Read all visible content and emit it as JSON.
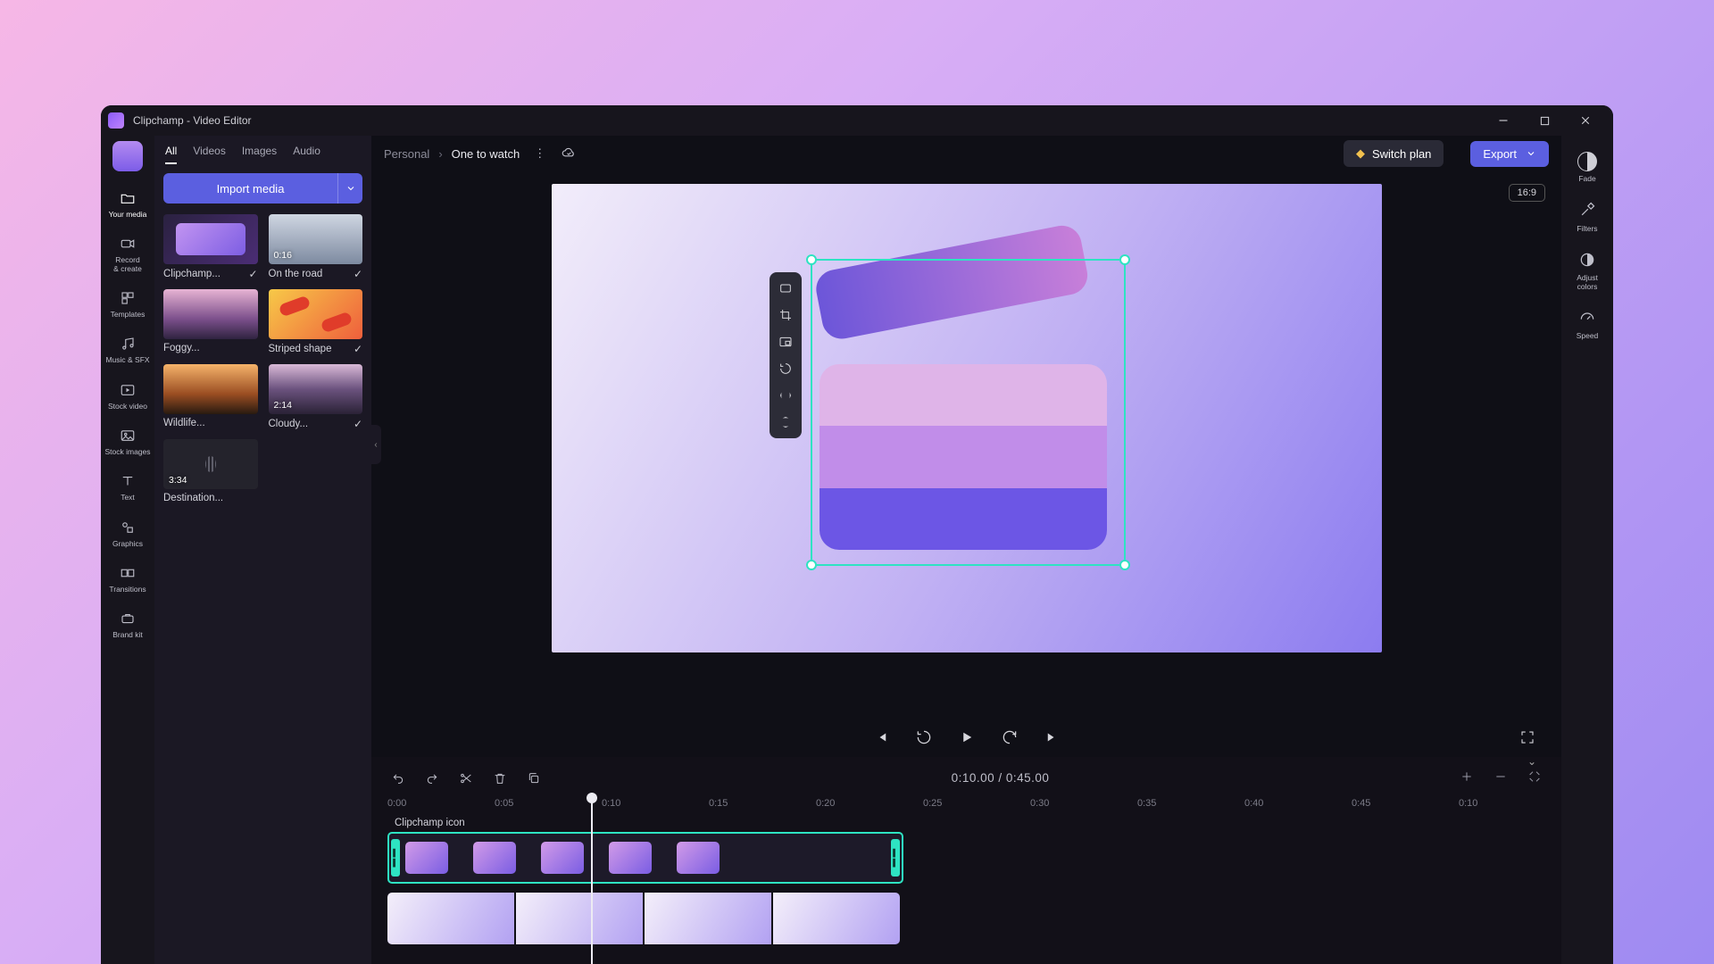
{
  "window": {
    "title": "Clipchamp - Video Editor"
  },
  "breadcrumb": {
    "workspace": "Personal",
    "project": "One to watch"
  },
  "header": {
    "switch_plan": "Switch plan",
    "export": "Export"
  },
  "aspect": "16:9",
  "rail": [
    {
      "id": "your-media",
      "label": "Your media"
    },
    {
      "id": "record",
      "label": "Record\n& create"
    },
    {
      "id": "templates",
      "label": "Templates"
    },
    {
      "id": "music",
      "label": "Music & SFX"
    },
    {
      "id": "stock-video",
      "label": "Stock video"
    },
    {
      "id": "stock-images",
      "label": "Stock images"
    },
    {
      "id": "text",
      "label": "Text"
    },
    {
      "id": "graphics",
      "label": "Graphics"
    },
    {
      "id": "transitions",
      "label": "Transitions"
    },
    {
      "id": "brand-kit",
      "label": "Brand kit"
    }
  ],
  "media_tabs": [
    "All",
    "Videos",
    "Images",
    "Audio"
  ],
  "import": {
    "label": "Import media"
  },
  "media": [
    {
      "name": "Clipchamp...",
      "dur": "",
      "added": true
    },
    {
      "name": "On the road",
      "dur": "0:16",
      "added": true
    },
    {
      "name": "Foggy...",
      "dur": "",
      "added": false
    },
    {
      "name": "Striped shape",
      "dur": "",
      "added": true
    },
    {
      "name": "Wildlife...",
      "dur": "",
      "added": false
    },
    {
      "name": "Cloudy...",
      "dur": "2:14",
      "added": true
    },
    {
      "name": "Destination...",
      "dur": "3:34",
      "added": false
    }
  ],
  "right_rail": [
    {
      "id": "fade",
      "label": "Fade"
    },
    {
      "id": "filters",
      "label": "Filters"
    },
    {
      "id": "adjust",
      "label": "Adjust\ncolors"
    },
    {
      "id": "speed",
      "label": "Speed"
    }
  ],
  "float_tools": [
    "fit",
    "crop",
    "pip",
    "rotate",
    "flip-h",
    "flip-v"
  ],
  "playback": {
    "current": "0:10.00",
    "sep": " / ",
    "total": "0:45.00"
  },
  "ruler_ticks": [
    "0:00",
    "0:05",
    "0:10",
    "0:15",
    "0:20",
    "0:25",
    "0:30",
    "0:35",
    "0:40",
    "0:45",
    "0:10"
  ],
  "timeline": {
    "selected_clip_label": "Clipchamp icon"
  }
}
